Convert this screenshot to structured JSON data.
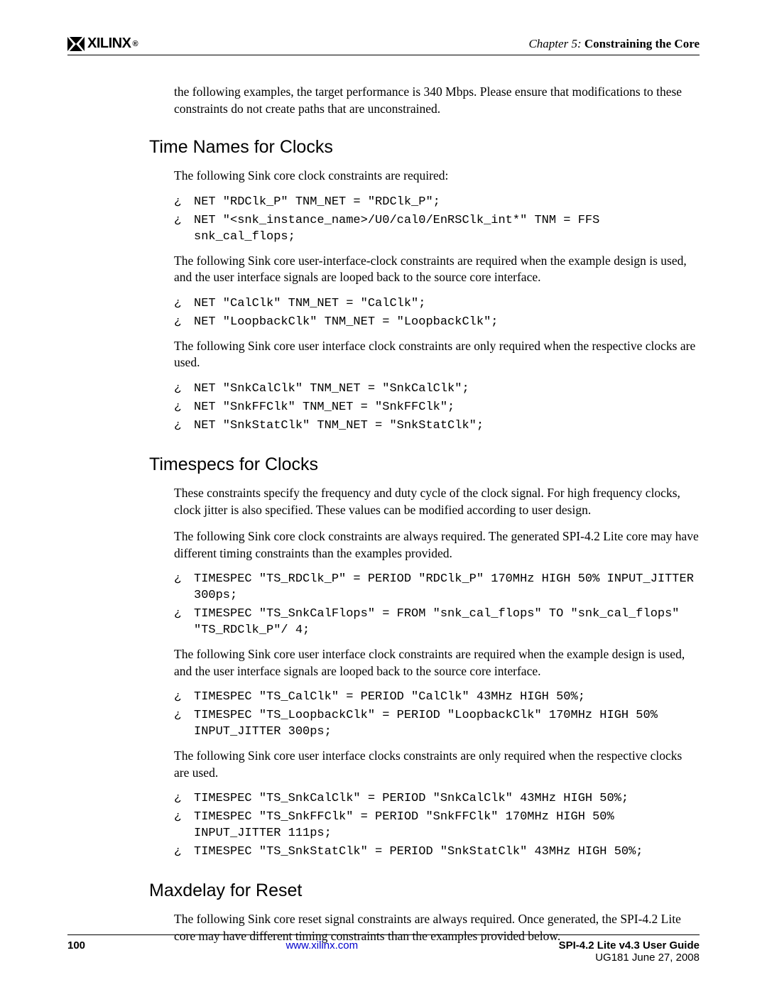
{
  "header": {
    "logo_text": "XILINX",
    "chapter_prefix": "Chapter 5:",
    "chapter_title": "Constraining the Core"
  },
  "intro": "the following examples, the target performance is 340 Mbps. Please ensure that modifications to these constraints do not create paths that are unconstrained.",
  "section1": {
    "heading": "Time Names for Clocks",
    "p1": "The following Sink core clock constraints are required:",
    "code1a": "NET \"RDClk_P\" TNM_NET = \"RDClk_P\";",
    "code1b": "NET \"<snk_instance_name>/U0/cal0/EnRSClk_int*\" TNM = FFS snk_cal_flops;",
    "p2": "The following Sink core user-interface-clock constraints are required when the example design is used, and the user interface signals are looped back to the source core interface.",
    "code2a": "NET \"CalClk\" TNM_NET = \"CalClk\";",
    "code2b": "NET \"LoopbackClk\" TNM_NET = \"LoopbackClk\";",
    "p3": "The following Sink core user interface clock constraints are only required when the respective clocks are used.",
    "code3a": "NET \"SnkCalClk\" TNM_NET = \"SnkCalClk\";",
    "code3b": "NET \"SnkFFClk\" TNM_NET = \"SnkFFClk\";",
    "code3c": "NET \"SnkStatClk\" TNM_NET = \"SnkStatClk\";"
  },
  "section2": {
    "heading": "Timespecs for Clocks",
    "p1": "These constraints specify the frequency and duty cycle of the clock signal. For high frequency clocks, clock jitter is also specified. These values can be modified according to user design.",
    "p2": "The following Sink core clock constraints are always required. The generated SPI-4.2 Lite core may have different timing constraints than the examples provided.",
    "code1a": "TIMESPEC \"TS_RDClk_P\" = PERIOD \"RDClk_P\" 170MHz HIGH 50% INPUT_JITTER 300ps;",
    "code1b": "TIMESPEC \"TS_SnkCalFlops\" = FROM \"snk_cal_flops\" TO \"snk_cal_flops\" \"TS_RDClk_P\"/ 4;",
    "p3": "The following Sink core user interface clock constraints are required when the example design is used, and the user interface signals are looped back to the source core interface.",
    "code2a": "TIMESPEC \"TS_CalClk\" = PERIOD \"CalClk\" 43MHz HIGH 50%;",
    "code2b": "TIMESPEC \"TS_LoopbackClk\" = PERIOD \"LoopbackClk\" 170MHz HIGH 50% INPUT_JITTER 300ps;",
    "p4": "The following Sink core user interface clocks constraints are only required when the respective clocks are used.",
    "code3a": "TIMESPEC \"TS_SnkCalClk\" = PERIOD \"SnkCalClk\" 43MHz HIGH 50%;",
    "code3b": "TIMESPEC \"TS_SnkFFClk\" = PERIOD \"SnkFFClk\" 170MHz HIGH 50% INPUT_JITTER 111ps;",
    "code3c": "TIMESPEC \"TS_SnkStatClk\" = PERIOD \"SnkStatClk\" 43MHz HIGH 50%;"
  },
  "section3": {
    "heading": "Maxdelay for Reset",
    "p1": "The following Sink core reset signal constraints are always required. Once generated, the SPI-4.2 Lite core may have different timing constraints than the examples provided below."
  },
  "footer": {
    "page_num": "100",
    "link": "www.xilinx.com",
    "title": "SPI-4.2 Lite v4.3 User Guide",
    "sub": "UG181 June 27, 2008"
  },
  "bullet": "¿"
}
